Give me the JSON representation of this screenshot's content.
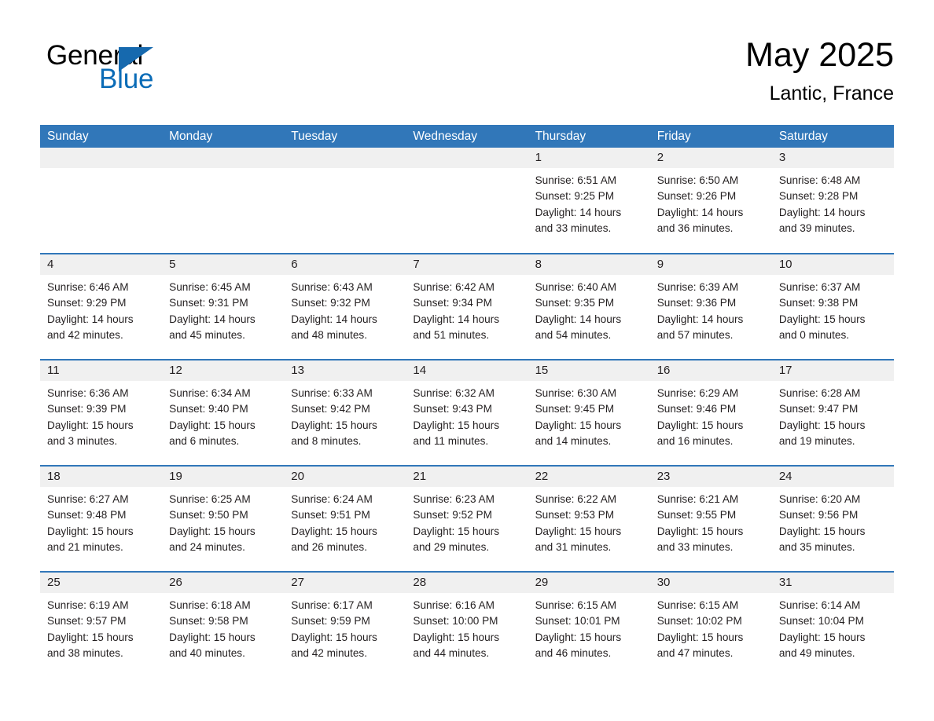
{
  "brand": {
    "logo_line1": "General",
    "logo_line2": "Blue",
    "accent_color": "#1669ae",
    "header_color": "#3177b9"
  },
  "header": {
    "month_title": "May 2025",
    "location": "Lantic, France"
  },
  "calendar": {
    "weekday_headers": [
      "Sunday",
      "Monday",
      "Tuesday",
      "Wednesday",
      "Thursday",
      "Friday",
      "Saturday"
    ],
    "weeks": [
      [
        {
          "day": "",
          "sunrise": "",
          "sunset": "",
          "daylight_line1": "",
          "daylight_line2": "",
          "empty": true
        },
        {
          "day": "",
          "sunrise": "",
          "sunset": "",
          "daylight_line1": "",
          "daylight_line2": "",
          "empty": true
        },
        {
          "day": "",
          "sunrise": "",
          "sunset": "",
          "daylight_line1": "",
          "daylight_line2": "",
          "empty": true
        },
        {
          "day": "",
          "sunrise": "",
          "sunset": "",
          "daylight_line1": "",
          "daylight_line2": "",
          "empty": true
        },
        {
          "day": "1",
          "sunrise": "Sunrise: 6:51 AM",
          "sunset": "Sunset: 9:25 PM",
          "daylight_line1": "Daylight: 14 hours",
          "daylight_line2": "and 33 minutes."
        },
        {
          "day": "2",
          "sunrise": "Sunrise: 6:50 AM",
          "sunset": "Sunset: 9:26 PM",
          "daylight_line1": "Daylight: 14 hours",
          "daylight_line2": "and 36 minutes."
        },
        {
          "day": "3",
          "sunrise": "Sunrise: 6:48 AM",
          "sunset": "Sunset: 9:28 PM",
          "daylight_line1": "Daylight: 14 hours",
          "daylight_line2": "and 39 minutes."
        }
      ],
      [
        {
          "day": "4",
          "sunrise": "Sunrise: 6:46 AM",
          "sunset": "Sunset: 9:29 PM",
          "daylight_line1": "Daylight: 14 hours",
          "daylight_line2": "and 42 minutes."
        },
        {
          "day": "5",
          "sunrise": "Sunrise: 6:45 AM",
          "sunset": "Sunset: 9:31 PM",
          "daylight_line1": "Daylight: 14 hours",
          "daylight_line2": "and 45 minutes."
        },
        {
          "day": "6",
          "sunrise": "Sunrise: 6:43 AM",
          "sunset": "Sunset: 9:32 PM",
          "daylight_line1": "Daylight: 14 hours",
          "daylight_line2": "and 48 minutes."
        },
        {
          "day": "7",
          "sunrise": "Sunrise: 6:42 AM",
          "sunset": "Sunset: 9:34 PM",
          "daylight_line1": "Daylight: 14 hours",
          "daylight_line2": "and 51 minutes."
        },
        {
          "day": "8",
          "sunrise": "Sunrise: 6:40 AM",
          "sunset": "Sunset: 9:35 PM",
          "daylight_line1": "Daylight: 14 hours",
          "daylight_line2": "and 54 minutes."
        },
        {
          "day": "9",
          "sunrise": "Sunrise: 6:39 AM",
          "sunset": "Sunset: 9:36 PM",
          "daylight_line1": "Daylight: 14 hours",
          "daylight_line2": "and 57 minutes."
        },
        {
          "day": "10",
          "sunrise": "Sunrise: 6:37 AM",
          "sunset": "Sunset: 9:38 PM",
          "daylight_line1": "Daylight: 15 hours",
          "daylight_line2": "and 0 minutes."
        }
      ],
      [
        {
          "day": "11",
          "sunrise": "Sunrise: 6:36 AM",
          "sunset": "Sunset: 9:39 PM",
          "daylight_line1": "Daylight: 15 hours",
          "daylight_line2": "and 3 minutes."
        },
        {
          "day": "12",
          "sunrise": "Sunrise: 6:34 AM",
          "sunset": "Sunset: 9:40 PM",
          "daylight_line1": "Daylight: 15 hours",
          "daylight_line2": "and 6 minutes."
        },
        {
          "day": "13",
          "sunrise": "Sunrise: 6:33 AM",
          "sunset": "Sunset: 9:42 PM",
          "daylight_line1": "Daylight: 15 hours",
          "daylight_line2": "and 8 minutes."
        },
        {
          "day": "14",
          "sunrise": "Sunrise: 6:32 AM",
          "sunset": "Sunset: 9:43 PM",
          "daylight_line1": "Daylight: 15 hours",
          "daylight_line2": "and 11 minutes."
        },
        {
          "day": "15",
          "sunrise": "Sunrise: 6:30 AM",
          "sunset": "Sunset: 9:45 PM",
          "daylight_line1": "Daylight: 15 hours",
          "daylight_line2": "and 14 minutes."
        },
        {
          "day": "16",
          "sunrise": "Sunrise: 6:29 AM",
          "sunset": "Sunset: 9:46 PM",
          "daylight_line1": "Daylight: 15 hours",
          "daylight_line2": "and 16 minutes."
        },
        {
          "day": "17",
          "sunrise": "Sunrise: 6:28 AM",
          "sunset": "Sunset: 9:47 PM",
          "daylight_line1": "Daylight: 15 hours",
          "daylight_line2": "and 19 minutes."
        }
      ],
      [
        {
          "day": "18",
          "sunrise": "Sunrise: 6:27 AM",
          "sunset": "Sunset: 9:48 PM",
          "daylight_line1": "Daylight: 15 hours",
          "daylight_line2": "and 21 minutes."
        },
        {
          "day": "19",
          "sunrise": "Sunrise: 6:25 AM",
          "sunset": "Sunset: 9:50 PM",
          "daylight_line1": "Daylight: 15 hours",
          "daylight_line2": "and 24 minutes."
        },
        {
          "day": "20",
          "sunrise": "Sunrise: 6:24 AM",
          "sunset": "Sunset: 9:51 PM",
          "daylight_line1": "Daylight: 15 hours",
          "daylight_line2": "and 26 minutes."
        },
        {
          "day": "21",
          "sunrise": "Sunrise: 6:23 AM",
          "sunset": "Sunset: 9:52 PM",
          "daylight_line1": "Daylight: 15 hours",
          "daylight_line2": "and 29 minutes."
        },
        {
          "day": "22",
          "sunrise": "Sunrise: 6:22 AM",
          "sunset": "Sunset: 9:53 PM",
          "daylight_line1": "Daylight: 15 hours",
          "daylight_line2": "and 31 minutes."
        },
        {
          "day": "23",
          "sunrise": "Sunrise: 6:21 AM",
          "sunset": "Sunset: 9:55 PM",
          "daylight_line1": "Daylight: 15 hours",
          "daylight_line2": "and 33 minutes."
        },
        {
          "day": "24",
          "sunrise": "Sunrise: 6:20 AM",
          "sunset": "Sunset: 9:56 PM",
          "daylight_line1": "Daylight: 15 hours",
          "daylight_line2": "and 35 minutes."
        }
      ],
      [
        {
          "day": "25",
          "sunrise": "Sunrise: 6:19 AM",
          "sunset": "Sunset: 9:57 PM",
          "daylight_line1": "Daylight: 15 hours",
          "daylight_line2": "and 38 minutes."
        },
        {
          "day": "26",
          "sunrise": "Sunrise: 6:18 AM",
          "sunset": "Sunset: 9:58 PM",
          "daylight_line1": "Daylight: 15 hours",
          "daylight_line2": "and 40 minutes."
        },
        {
          "day": "27",
          "sunrise": "Sunrise: 6:17 AM",
          "sunset": "Sunset: 9:59 PM",
          "daylight_line1": "Daylight: 15 hours",
          "daylight_line2": "and 42 minutes."
        },
        {
          "day": "28",
          "sunrise": "Sunrise: 6:16 AM",
          "sunset": "Sunset: 10:00 PM",
          "daylight_line1": "Daylight: 15 hours",
          "daylight_line2": "and 44 minutes."
        },
        {
          "day": "29",
          "sunrise": "Sunrise: 6:15 AM",
          "sunset": "Sunset: 10:01 PM",
          "daylight_line1": "Daylight: 15 hours",
          "daylight_line2": "and 46 minutes."
        },
        {
          "day": "30",
          "sunrise": "Sunrise: 6:15 AM",
          "sunset": "Sunset: 10:02 PM",
          "daylight_line1": "Daylight: 15 hours",
          "daylight_line2": "and 47 minutes."
        },
        {
          "day": "31",
          "sunrise": "Sunrise: 6:14 AM",
          "sunset": "Sunset: 10:04 PM",
          "daylight_line1": "Daylight: 15 hours",
          "daylight_line2": "and 49 minutes."
        }
      ]
    ]
  }
}
